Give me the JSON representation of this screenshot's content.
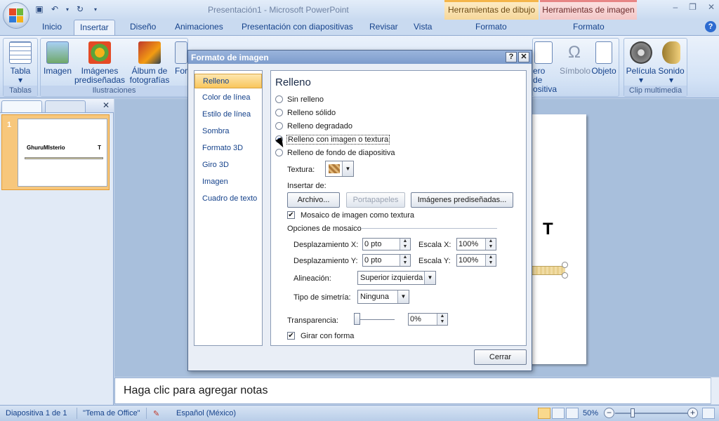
{
  "window": {
    "title": "Presentación1 - Microsoft PowerPoint",
    "context_tabs": {
      "drawing": "Herramientas de dibujo",
      "image": "Herramientas de imagen"
    }
  },
  "ribbon": {
    "tabs": [
      "Inicio",
      "Insertar",
      "Diseño",
      "Animaciones",
      "Presentación con diapositivas",
      "Revisar",
      "Vista",
      "Formato",
      "Formato"
    ],
    "active_tab": "Insertar",
    "groups": {
      "tablas": {
        "label": "Tablas",
        "buttons": [
          "Tabla"
        ]
      },
      "ilustraciones": {
        "label": "Ilustraciones",
        "buttons": [
          "Imagen",
          "Imágenes",
          "prediseñadas",
          "Álbum de",
          "fotografías",
          "For"
        ]
      },
      "texto_fragments": [
        "ero de",
        "ositiva"
      ],
      "simbolos": {
        "buttons": [
          "Símbolo",
          "Objeto"
        ]
      },
      "clip": {
        "label": "Clip multimedia",
        "buttons": [
          "Película",
          "Sonido"
        ]
      }
    }
  },
  "slides_pane": {
    "slide_number": "1",
    "thumb_title": "GhuruMIsterio",
    "thumb_t": "T"
  },
  "slide": {
    "letter": "T"
  },
  "notes": {
    "placeholder": "Haga clic para agregar notas"
  },
  "status": {
    "slide_info": "Diapositiva 1 de 1",
    "theme": "\"Tema de Office\"",
    "language": "Español (México)",
    "zoom": "50%"
  },
  "dialog": {
    "title": "Formato de imagen",
    "help": "?",
    "close_x": "✕",
    "nav": [
      "Relleno",
      "Color de línea",
      "Estilo de línea",
      "Sombra",
      "Formato 3D",
      "Giro 3D",
      "Imagen",
      "Cuadro de texto"
    ],
    "selected_nav": "Relleno",
    "heading": "Relleno",
    "fill_options": [
      "Sin relleno",
      "Relleno sólido",
      "Relleno degradado",
      "Relleno con imagen o textura",
      "Relleno de fondo de diapositiva"
    ],
    "selected_fill": "Relleno con imagen o textura",
    "texture_label": "Textura:",
    "insert_from_label": "Insertar de:",
    "btn_file": "Archivo...",
    "btn_clipboard": "Portapapeles",
    "btn_clipart": "Imágenes prediseñadas...",
    "tile_checkbox": "Mosaico de imagen como textura",
    "tile_checked": true,
    "tile_options_label": "Opciones de mosaico",
    "offset_x_label": "Desplazamiento X:",
    "offset_x": "0 pto",
    "scale_x_label": "Escala X:",
    "scale_x": "100%",
    "offset_y_label": "Desplazamiento Y:",
    "offset_y": "0 pto",
    "scale_y_label": "Escala Y:",
    "scale_y": "100%",
    "alignment_label": "Alineación:",
    "alignment": "Superior izquierda",
    "mirror_label": "Tipo de simetría:",
    "mirror": "Ninguna",
    "transparency_label": "Transparencia:",
    "transparency": "0%",
    "transparency_level": 0,
    "rotate_checkbox": "Girar con forma",
    "rotate_checked": true,
    "close_button": "Cerrar"
  }
}
